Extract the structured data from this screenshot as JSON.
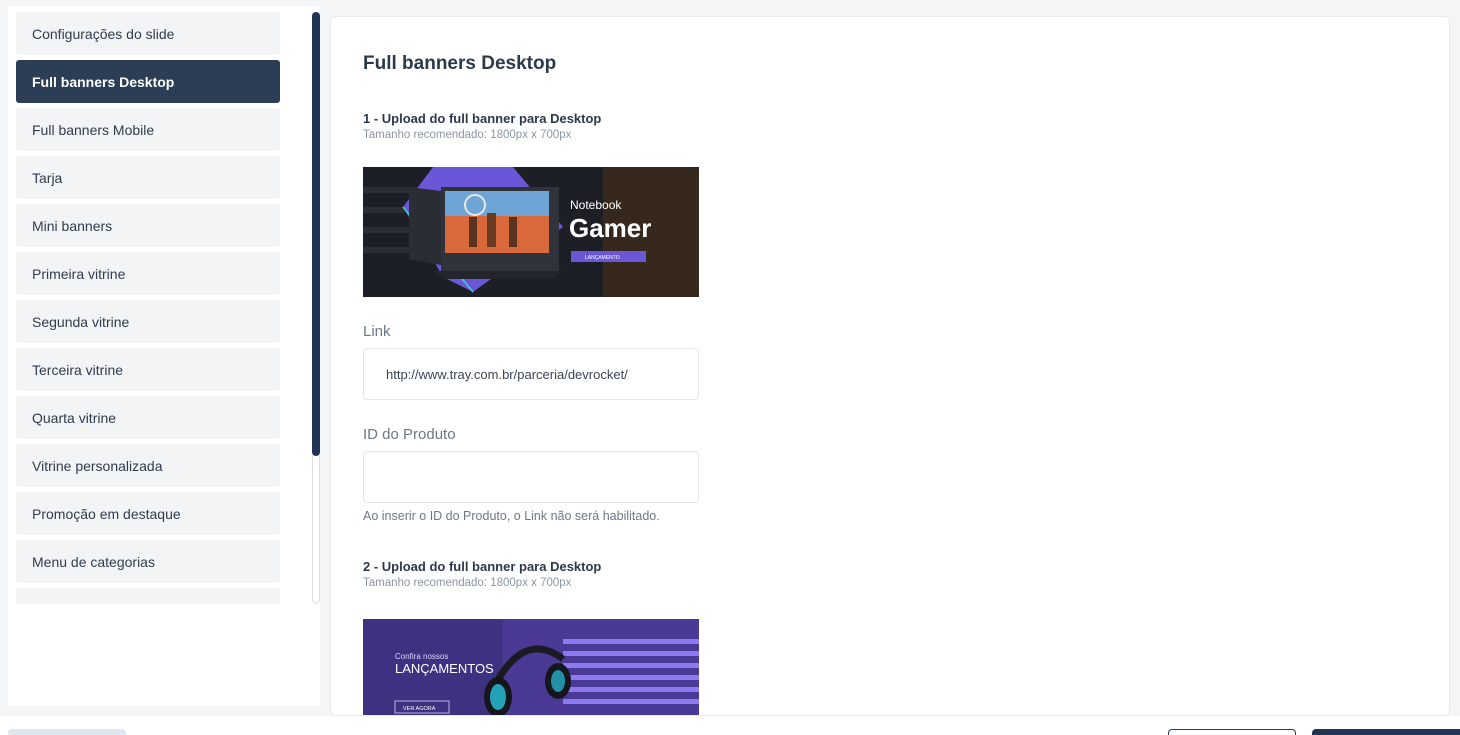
{
  "sidebar": {
    "items": [
      {
        "label": "Configurações do slide",
        "active": false
      },
      {
        "label": "Full banners Desktop",
        "active": true
      },
      {
        "label": "Full banners Mobile",
        "active": false
      },
      {
        "label": "Tarja",
        "active": false
      },
      {
        "label": "Mini banners",
        "active": false
      },
      {
        "label": "Primeira vitrine",
        "active": false
      },
      {
        "label": "Segunda vitrine",
        "active": false
      },
      {
        "label": "Terceira vitrine",
        "active": false
      },
      {
        "label": "Quarta vitrine",
        "active": false
      },
      {
        "label": "Vitrine personalizada",
        "active": false
      },
      {
        "label": "Promoção em destaque",
        "active": false
      },
      {
        "label": "Menu de categorias",
        "active": false
      }
    ]
  },
  "main": {
    "title": "Full banners Desktop",
    "upload1": {
      "title": "1 - Upload do full banner para Desktop",
      "hint": "Tamanho recomendado: 1800px x 700px",
      "banner": {
        "line1": "Notebook",
        "line2": "Gamer",
        "cta": "LANÇAMENTO"
      }
    },
    "link": {
      "label": "Link",
      "value": "http://www.tray.com.br/parceria/devrocket/"
    },
    "product_id": {
      "label": "ID do Produto",
      "value": "",
      "help": "Ao inserir o ID do Produto, o Link não será habilitado."
    },
    "upload2": {
      "title": "2 - Upload do full banner para Desktop",
      "hint": "Tamanho recomendado: 1800px x 700px",
      "banner": {
        "line1": "Confira nossos",
        "line2": "LANÇAMENTOS",
        "cta": "VER AGORA"
      }
    }
  },
  "colors": {
    "accent": "#2c3e55",
    "scrollbar": "#1f3553",
    "banner_purple": "#6d5ad6"
  }
}
